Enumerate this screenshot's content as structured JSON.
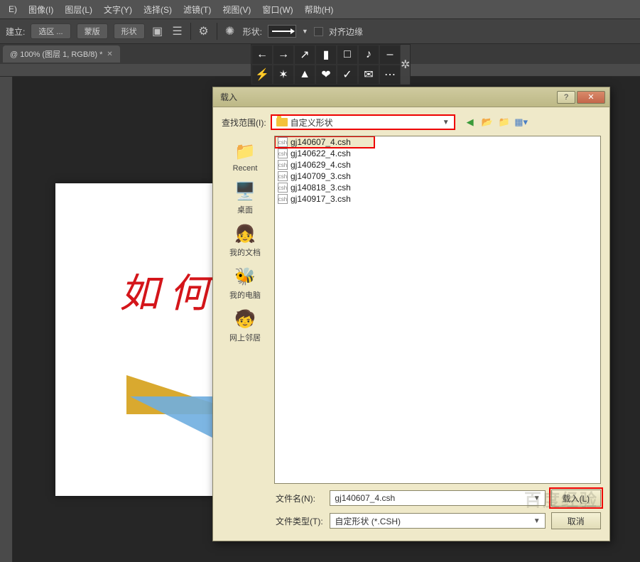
{
  "menubar": [
    "E)",
    "图像(I)",
    "图层(L)",
    "文字(Y)",
    "选择(S)",
    "滤镜(T)",
    "视图(V)",
    "窗口(W)",
    "帮助(H)"
  ],
  "optbar": {
    "build": "建立:",
    "btn_sel": "选区 ...",
    "btn_mask": "蒙版",
    "btn_shape": "形状",
    "shape_lbl": "形状:",
    "align": "对齐边缘"
  },
  "tab": {
    "title": "@ 100% (图层 1, RGB/8) *"
  },
  "doc": {
    "red_text": "如 何"
  },
  "shapes_grid_alt": [
    "←",
    "→",
    "↗",
    "▮",
    "□",
    "♪",
    "–",
    "⚡",
    "✶",
    "▲",
    "❤",
    "✓",
    "✉",
    "⋯"
  ],
  "dialog": {
    "title": "载入",
    "lookin_label": "查找范围(I):",
    "lookin_value": "自定义形状",
    "places": [
      {
        "icon": "📁",
        "label": "Recent"
      },
      {
        "icon": "🖥️",
        "label": "桌面"
      },
      {
        "icon": "👧",
        "label": "我的文档"
      },
      {
        "icon": "🐝",
        "label": "我的电脑"
      },
      {
        "icon": "🧒",
        "label": "网上邻居"
      }
    ],
    "files": [
      {
        "name": "gj140607_4.csh",
        "selected": true
      },
      {
        "name": "gj140622_4.csh",
        "selected": false
      },
      {
        "name": "gj140629_4.csh",
        "selected": false
      },
      {
        "name": "gj140709_3.csh",
        "selected": false
      },
      {
        "name": "gj140818_3.csh",
        "selected": false
      },
      {
        "name": "gj140917_3.csh",
        "selected": false
      }
    ],
    "filename_label": "文件名(N):",
    "filename_value": "gj140607_4.csh",
    "filetype_label": "文件类型(T):",
    "filetype_value": "自定形状 (*.CSH)",
    "btn_load": "载入(L)",
    "btn_cancel": "取消"
  },
  "watermark": "百度经验"
}
